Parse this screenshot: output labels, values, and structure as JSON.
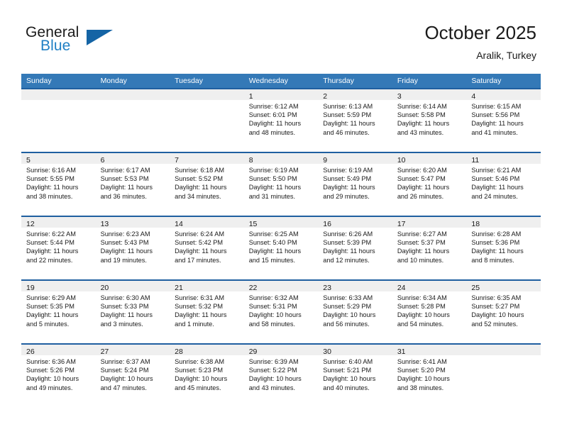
{
  "brand": {
    "name_top": "General",
    "name_bottom": "Blue",
    "triangle_icon": "triangle-icon",
    "color_primary": "#1464a5",
    "color_text": "#1a1a1a"
  },
  "header": {
    "title": "October 2025",
    "subtitle": "Aralik, Turkey"
  },
  "theme": {
    "header_row_bg": "#3479b7",
    "cell_top_border": "#1f5fa0",
    "daynum_band_bg": "#efefef",
    "page_bg": "#ffffff"
  },
  "weekday_headers": [
    "Sunday",
    "Monday",
    "Tuesday",
    "Wednesday",
    "Thursday",
    "Friday",
    "Saturday"
  ],
  "weeks": [
    [
      {
        "day": "",
        "lines": []
      },
      {
        "day": "",
        "lines": []
      },
      {
        "day": "",
        "lines": []
      },
      {
        "day": "1",
        "lines": [
          "Sunrise: 6:12 AM",
          "Sunset: 6:01 PM",
          "Daylight: 11 hours",
          "and 48 minutes."
        ]
      },
      {
        "day": "2",
        "lines": [
          "Sunrise: 6:13 AM",
          "Sunset: 5:59 PM",
          "Daylight: 11 hours",
          "and 46 minutes."
        ]
      },
      {
        "day": "3",
        "lines": [
          "Sunrise: 6:14 AM",
          "Sunset: 5:58 PM",
          "Daylight: 11 hours",
          "and 43 minutes."
        ]
      },
      {
        "day": "4",
        "lines": [
          "Sunrise: 6:15 AM",
          "Sunset: 5:56 PM",
          "Daylight: 11 hours",
          "and 41 minutes."
        ]
      }
    ],
    [
      {
        "day": "5",
        "lines": [
          "Sunrise: 6:16 AM",
          "Sunset: 5:55 PM",
          "Daylight: 11 hours",
          "and 38 minutes."
        ]
      },
      {
        "day": "6",
        "lines": [
          "Sunrise: 6:17 AM",
          "Sunset: 5:53 PM",
          "Daylight: 11 hours",
          "and 36 minutes."
        ]
      },
      {
        "day": "7",
        "lines": [
          "Sunrise: 6:18 AM",
          "Sunset: 5:52 PM",
          "Daylight: 11 hours",
          "and 34 minutes."
        ]
      },
      {
        "day": "8",
        "lines": [
          "Sunrise: 6:19 AM",
          "Sunset: 5:50 PM",
          "Daylight: 11 hours",
          "and 31 minutes."
        ]
      },
      {
        "day": "9",
        "lines": [
          "Sunrise: 6:19 AM",
          "Sunset: 5:49 PM",
          "Daylight: 11 hours",
          "and 29 minutes."
        ]
      },
      {
        "day": "10",
        "lines": [
          "Sunrise: 6:20 AM",
          "Sunset: 5:47 PM",
          "Daylight: 11 hours",
          "and 26 minutes."
        ]
      },
      {
        "day": "11",
        "lines": [
          "Sunrise: 6:21 AM",
          "Sunset: 5:46 PM",
          "Daylight: 11 hours",
          "and 24 minutes."
        ]
      }
    ],
    [
      {
        "day": "12",
        "lines": [
          "Sunrise: 6:22 AM",
          "Sunset: 5:44 PM",
          "Daylight: 11 hours",
          "and 22 minutes."
        ]
      },
      {
        "day": "13",
        "lines": [
          "Sunrise: 6:23 AM",
          "Sunset: 5:43 PM",
          "Daylight: 11 hours",
          "and 19 minutes."
        ]
      },
      {
        "day": "14",
        "lines": [
          "Sunrise: 6:24 AM",
          "Sunset: 5:42 PM",
          "Daylight: 11 hours",
          "and 17 minutes."
        ]
      },
      {
        "day": "15",
        "lines": [
          "Sunrise: 6:25 AM",
          "Sunset: 5:40 PM",
          "Daylight: 11 hours",
          "and 15 minutes."
        ]
      },
      {
        "day": "16",
        "lines": [
          "Sunrise: 6:26 AM",
          "Sunset: 5:39 PM",
          "Daylight: 11 hours",
          "and 12 minutes."
        ]
      },
      {
        "day": "17",
        "lines": [
          "Sunrise: 6:27 AM",
          "Sunset: 5:37 PM",
          "Daylight: 11 hours",
          "and 10 minutes."
        ]
      },
      {
        "day": "18",
        "lines": [
          "Sunrise: 6:28 AM",
          "Sunset: 5:36 PM",
          "Daylight: 11 hours",
          "and 8 minutes."
        ]
      }
    ],
    [
      {
        "day": "19",
        "lines": [
          "Sunrise: 6:29 AM",
          "Sunset: 5:35 PM",
          "Daylight: 11 hours",
          "and 5 minutes."
        ]
      },
      {
        "day": "20",
        "lines": [
          "Sunrise: 6:30 AM",
          "Sunset: 5:33 PM",
          "Daylight: 11 hours",
          "and 3 minutes."
        ]
      },
      {
        "day": "21",
        "lines": [
          "Sunrise: 6:31 AM",
          "Sunset: 5:32 PM",
          "Daylight: 11 hours",
          "and 1 minute."
        ]
      },
      {
        "day": "22",
        "lines": [
          "Sunrise: 6:32 AM",
          "Sunset: 5:31 PM",
          "Daylight: 10 hours",
          "and 58 minutes."
        ]
      },
      {
        "day": "23",
        "lines": [
          "Sunrise: 6:33 AM",
          "Sunset: 5:29 PM",
          "Daylight: 10 hours",
          "and 56 minutes."
        ]
      },
      {
        "day": "24",
        "lines": [
          "Sunrise: 6:34 AM",
          "Sunset: 5:28 PM",
          "Daylight: 10 hours",
          "and 54 minutes."
        ]
      },
      {
        "day": "25",
        "lines": [
          "Sunrise: 6:35 AM",
          "Sunset: 5:27 PM",
          "Daylight: 10 hours",
          "and 52 minutes."
        ]
      }
    ],
    [
      {
        "day": "26",
        "lines": [
          "Sunrise: 6:36 AM",
          "Sunset: 5:26 PM",
          "Daylight: 10 hours",
          "and 49 minutes."
        ]
      },
      {
        "day": "27",
        "lines": [
          "Sunrise: 6:37 AM",
          "Sunset: 5:24 PM",
          "Daylight: 10 hours",
          "and 47 minutes."
        ]
      },
      {
        "day": "28",
        "lines": [
          "Sunrise: 6:38 AM",
          "Sunset: 5:23 PM",
          "Daylight: 10 hours",
          "and 45 minutes."
        ]
      },
      {
        "day": "29",
        "lines": [
          "Sunrise: 6:39 AM",
          "Sunset: 5:22 PM",
          "Daylight: 10 hours",
          "and 43 minutes."
        ]
      },
      {
        "day": "30",
        "lines": [
          "Sunrise: 6:40 AM",
          "Sunset: 5:21 PM",
          "Daylight: 10 hours",
          "and 40 minutes."
        ]
      },
      {
        "day": "31",
        "lines": [
          "Sunrise: 6:41 AM",
          "Sunset: 5:20 PM",
          "Daylight: 10 hours",
          "and 38 minutes."
        ]
      },
      {
        "day": "",
        "lines": []
      }
    ]
  ]
}
